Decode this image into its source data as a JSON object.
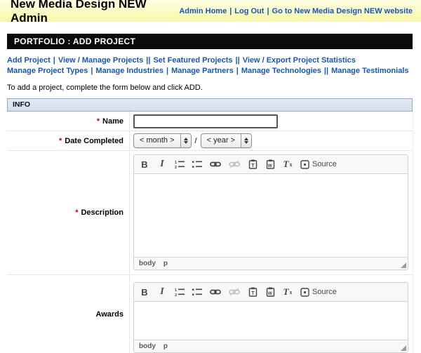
{
  "colors": {
    "link_blue": "#1557b8",
    "header_gradient_top": "#ffffe4",
    "header_gradient_bottom": "#f7f7a8",
    "section_bar_bg": "#0b0b0b",
    "info_bar_bg": "#dbe4f0",
    "info_bar_border": "#9aa9bc",
    "required_red": "#cc0000",
    "editor_chrome": "#f8f8f8",
    "editor_border": "#d1d1d1",
    "toolbar_icon": "#474747"
  },
  "header": {
    "title": "New Media Design NEW Admin",
    "links": [
      {
        "label": "Admin Home"
      },
      {
        "label": "Log Out"
      },
      {
        "label": "Go to New Media Design NEW website"
      }
    ],
    "separator": "|"
  },
  "page": {
    "section_title": "PORTFOLIO : ADD PROJECT",
    "nav_row1": [
      {
        "label": "Add Project",
        "sep": "|"
      },
      {
        "label": "View / Manage Projects",
        "sep": "||"
      },
      {
        "label": "Set Featured Projects",
        "sep": "||"
      },
      {
        "label": "View / Export Project Statistics",
        "sep": ""
      }
    ],
    "nav_row2": [
      {
        "label": "Manage Project Types",
        "sep": "|"
      },
      {
        "label": "Manage Industries",
        "sep": "|"
      },
      {
        "label": "Manage Partners",
        "sep": "|"
      },
      {
        "label": "Manage Technologies",
        "sep": "||"
      },
      {
        "label": "Manage Testimonials",
        "sep": ""
      }
    ],
    "intro": "To add a project, complete the form below and click ADD.",
    "info_header": "INFO"
  },
  "form": {
    "required_marker": "*",
    "name": {
      "label": "Name",
      "value": ""
    },
    "date": {
      "label": "Date Completed",
      "month_value": "< month >",
      "year_value": "< year >",
      "separator": "/"
    },
    "description": {
      "label": "Description"
    },
    "awards": {
      "label": "Awards"
    }
  },
  "editor": {
    "bold_label": "B",
    "italic_label": "I",
    "removeformat_t": "T",
    "removeformat_x": "x",
    "paste_text_letter": "T",
    "paste_word_letter": "W",
    "source_label": "Source",
    "path_body": "body",
    "path_p": "p"
  }
}
